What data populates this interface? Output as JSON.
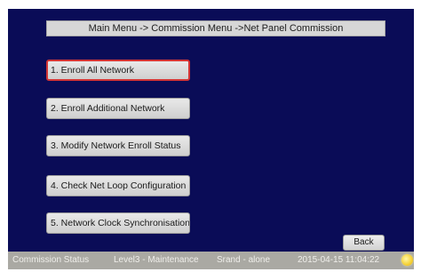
{
  "header": {
    "breadcrumb": "Main Menu -> Commission Menu ->Net Panel Commission"
  },
  "menu": {
    "items": [
      {
        "label": "1. Enroll All Network",
        "selected": true
      },
      {
        "label": "2. Enroll Additional Network",
        "selected": false
      },
      {
        "label": "3. Modify Network Enroll Status",
        "selected": false
      },
      {
        "label": "4. Check Net Loop Configuration",
        "selected": false
      },
      {
        "label": "5. Network Clock Synchronisation",
        "selected": false
      }
    ]
  },
  "back_button": {
    "label": "Back"
  },
  "status_bar": {
    "commission_status": "Commission Status",
    "access_level": "Level3 - Maintenance",
    "mode": "Srand - alone",
    "datetime": "2015-04-15 11:04:22",
    "indicator_icon": "sun-icon"
  },
  "colors": {
    "screen_background": "#0a0c57",
    "selected_border": "#d43535",
    "status_bar": "#aaa9a3"
  }
}
